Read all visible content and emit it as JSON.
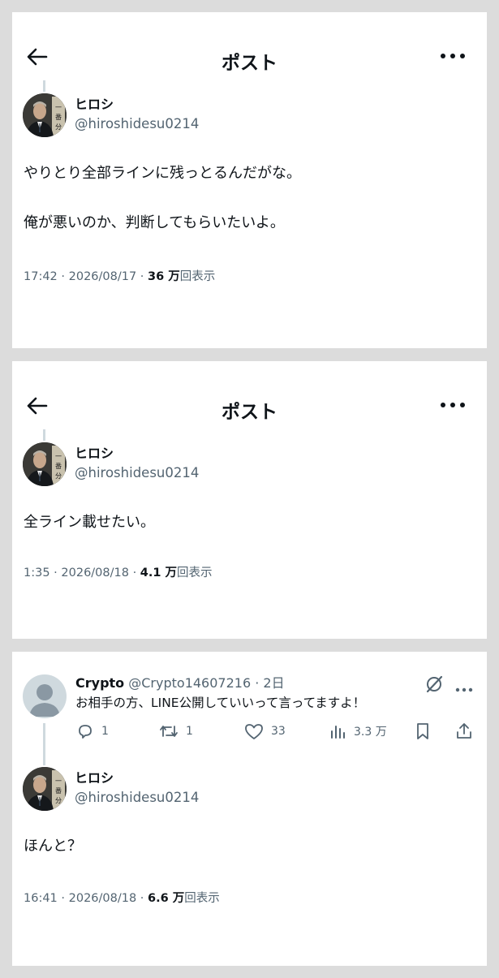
{
  "cards": [
    {
      "header_title": "ポスト",
      "author": {
        "name": "ヒロシ",
        "handle": "@hiroshidesu0214"
      },
      "text_lines": [
        "やりとり全部ラインに残っとるんだがな。",
        "俺が悪いのか、判断してもらいたいよ。"
      ],
      "meta": {
        "time_date": "17:42 · 2026/08/17 · ",
        "views_count": "36 万",
        "views_label": "回表示"
      }
    },
    {
      "header_title": "ポスト",
      "author": {
        "name": "ヒロシ",
        "handle": "@hiroshidesu0214"
      },
      "text_lines": [
        "全ライン載せたい。"
      ],
      "meta": {
        "time_date": "1:35 · 2026/08/18 · ",
        "views_count": "4.1 万",
        "views_label": "回表示"
      }
    },
    {
      "reply": {
        "name": "Crypto",
        "handle": "@Crypto14607216",
        "age": "2日",
        "text": "お相手の方、LINE公開していいって言ってますよ！",
        "actions": {
          "replies": "1",
          "reposts": "1",
          "likes": "33",
          "views": "3.3 万"
        }
      },
      "author": {
        "name": "ヒロシ",
        "handle": "@hiroshidesu0214"
      },
      "text_lines": [
        "ほんと？"
      ],
      "meta": {
        "time_date": "16:41 · 2026/08/18 · ",
        "views_count": "6.6 万",
        "views_label": "回表示"
      }
    }
  ],
  "icons": {
    "back": "arrow-left-icon",
    "more": "more-dots-icon",
    "reply": "speech-bubble-icon",
    "repost": "repost-icon",
    "like": "heart-icon",
    "views": "bar-chart-icon",
    "bookmark": "bookmark-icon",
    "share": "share-icon",
    "grok": "grok-icon"
  },
  "colors": {
    "text": "#0f1419",
    "secondary": "#536471",
    "background": "#dcdcdc",
    "card": "#ffffff"
  }
}
